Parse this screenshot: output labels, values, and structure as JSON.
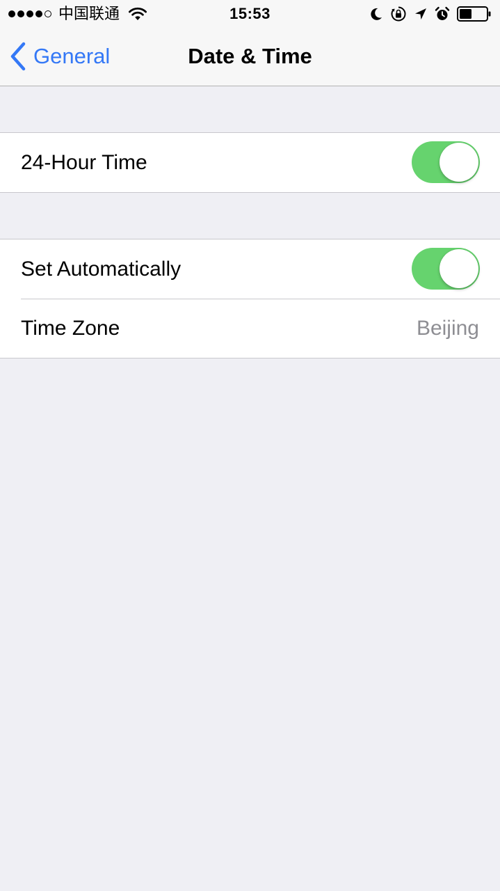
{
  "status_bar": {
    "signal_filled": 4,
    "signal_total": 5,
    "carrier": "中国联通",
    "time": "15:53",
    "icons": [
      "wifi-icon",
      "moon-icon",
      "orientation-lock-icon",
      "location-arrow-icon",
      "alarm-icon",
      "battery-icon"
    ],
    "battery_level": 0.45
  },
  "nav": {
    "back_label": "General",
    "title": "Date & Time",
    "accent_color": "#3478f6"
  },
  "settings": {
    "twenty_four_hour": {
      "label": "24-Hour Time",
      "enabled": true
    },
    "set_automatically": {
      "label": "Set Automatically",
      "enabled": true
    },
    "time_zone": {
      "label": "Time Zone",
      "value": "Beijing"
    }
  },
  "colors": {
    "toggle_on": "#66d36e",
    "background": "#efeff4",
    "value_text": "#8e8e93"
  }
}
